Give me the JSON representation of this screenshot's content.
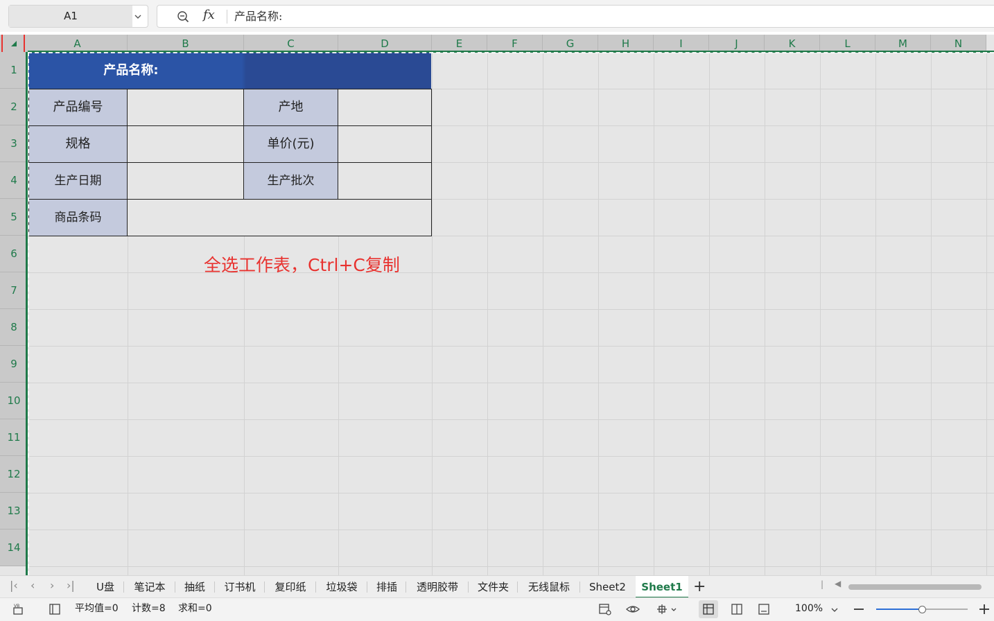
{
  "formula_bar": {
    "name_box": "A1",
    "fx_label": "fx",
    "content": "产品名称:"
  },
  "columns": [
    "A",
    "B",
    "C",
    "D",
    "E",
    "F",
    "G",
    "H",
    "I",
    "J",
    "K",
    "L",
    "M",
    "N"
  ],
  "rows": [
    "1",
    "2",
    "3",
    "4",
    "5",
    "6",
    "7",
    "8",
    "9",
    "10",
    "11",
    "12",
    "13",
    "14"
  ],
  "table": {
    "title": "产品名称:",
    "labels": {
      "product_no": "产品编号",
      "origin": "产地",
      "spec": "规格",
      "unit_price": "单价(元)",
      "prod_date": "生产日期",
      "batch": "生产批次",
      "barcode": "商品条码"
    }
  },
  "annotation": "全选工作表，Ctrl+C复制",
  "sheet_tabs": [
    "U盘",
    "笔记本",
    "抽纸",
    "订书机",
    "复印纸",
    "垃圾袋",
    "排插",
    "透明胶带",
    "文件夹",
    "无线鼠标",
    "Sheet2",
    "Sheet1"
  ],
  "active_tab": "Sheet1",
  "add_tab": "+",
  "status": {
    "average": "平均值=0",
    "count": "计数=8",
    "sum": "求和=0",
    "zoom": "100%",
    "zoom_level_percent": 50
  },
  "colors": {
    "accent": "#1f7a4a",
    "title_bg": "#2b54a6",
    "label_bg": "#c4cadd",
    "annotation": "#e8322f"
  }
}
